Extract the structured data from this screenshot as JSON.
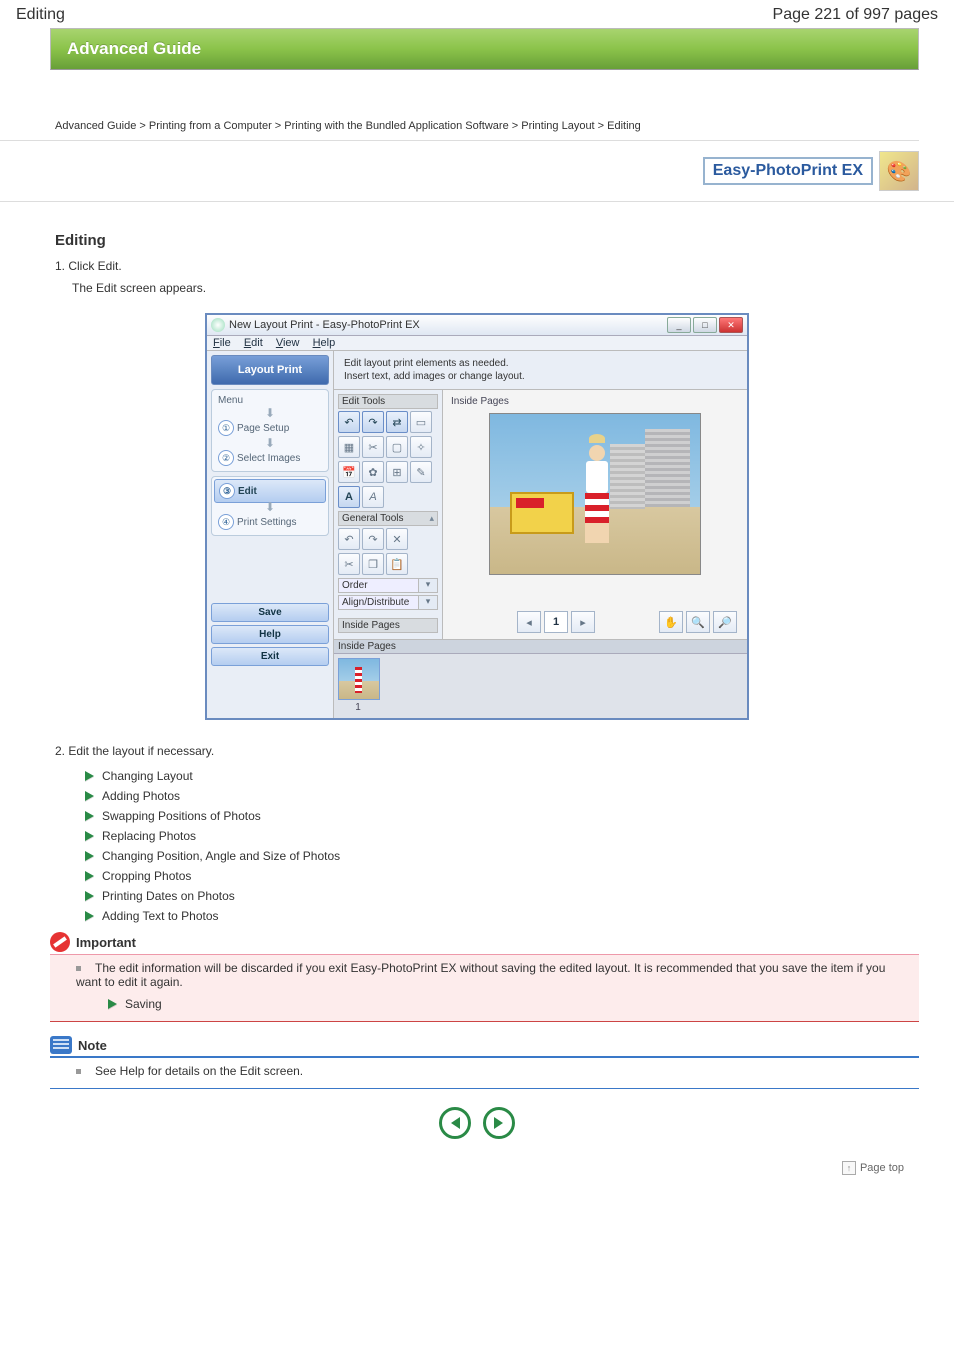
{
  "header": {
    "left": "Editing",
    "right": "Page 221 of 997 pages"
  },
  "adv_guide": "Advanced Guide",
  "breadcrumb": "Advanced Guide > Printing from a Computer > Printing with the Bundled Application Software > Printing Layout > Editing",
  "logo_text": "Easy-PhotoPrint EX",
  "section_title": "Editing",
  "intro1": "1. Click Edit.",
  "intro2": "The Edit screen appears.",
  "screenshot": {
    "title": "New Layout Print - Easy-PhotoPrint EX",
    "menubar": {
      "file": "File",
      "edit": "Edit",
      "view": "View",
      "help": "Help"
    },
    "banner": "Layout Print",
    "steps": {
      "menu": "Menu",
      "s1_num": "①",
      "s1": "Page Setup",
      "s2_num": "②",
      "s2": "Select Images",
      "s3_num": "③",
      "s3": "Edit",
      "s4_num": "④",
      "s4": "Print Settings"
    },
    "btn_save": "Save",
    "btn_help": "Help",
    "btn_exit": "Exit",
    "instr_l1": "Edit layout print elements as needed.",
    "instr_l2": "Insert text, add images or change layout.",
    "edit_tools": "Edit Tools",
    "general_tools": "General Tools",
    "order": "Order",
    "align": "Align/Distribute",
    "inside_pages": "Inside Pages",
    "page_cur": "1",
    "thumb_hd": "Inside Pages",
    "thumb_num": "1"
  },
  "intro3": "2. Edit the layout if necessary.",
  "functions": [
    "Changing Layout",
    "Adding Photos",
    "Swapping Positions of Photos",
    "Replacing Photos",
    "Changing Position, Angle and Size of Photos",
    "Cropping Photos",
    "Printing Dates on Photos",
    "Adding Text to Photos"
  ],
  "important": {
    "title": "Important",
    "line": "The edit information will be discarded if you exit Easy-PhotoPrint EX without saving the edited layout. It is recommended that you save the item if you want to edit it again.",
    "sub": "Saving"
  },
  "note": {
    "title": "Note",
    "line": "See Help for details on the Edit screen."
  },
  "pagetop": "Page top"
}
